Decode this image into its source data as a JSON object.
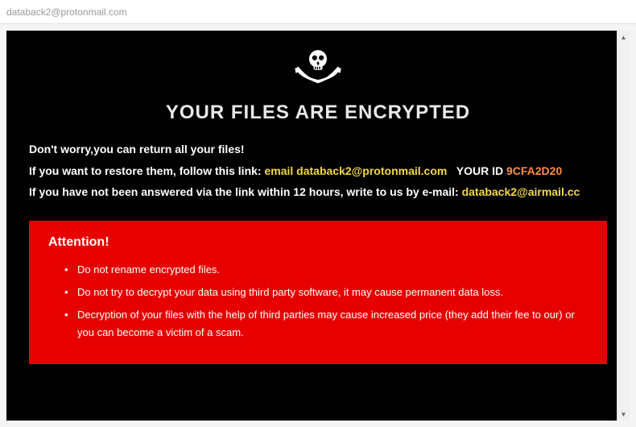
{
  "window": {
    "title": "databack2@protonmail.com"
  },
  "header": {
    "title": "YOUR FILES ARE ENCRYPTED"
  },
  "info": {
    "line1": "Don't worry,you can return all your files!",
    "line2_prefix": "If you want to restore them, follow this link: ",
    "line2_email_label": "email ",
    "line2_email": "databack2@protonmail.com",
    "line2_id_label": "   YOUR ID ",
    "line2_id_value": "9CFA2D20",
    "line3_prefix": "If you have not been answered via the link within 12 hours, write to us by e-mail: ",
    "line3_email": "databack2@airmail.cc"
  },
  "attention": {
    "title": "Attention!",
    "items": [
      "Do not rename encrypted files.",
      "Do not try to decrypt your data using third party software, it may cause permanent data loss.",
      "Decryption of your files with the help of third parties may cause increased price (they add their fee to our) or you can become a victim of a scam."
    ]
  }
}
